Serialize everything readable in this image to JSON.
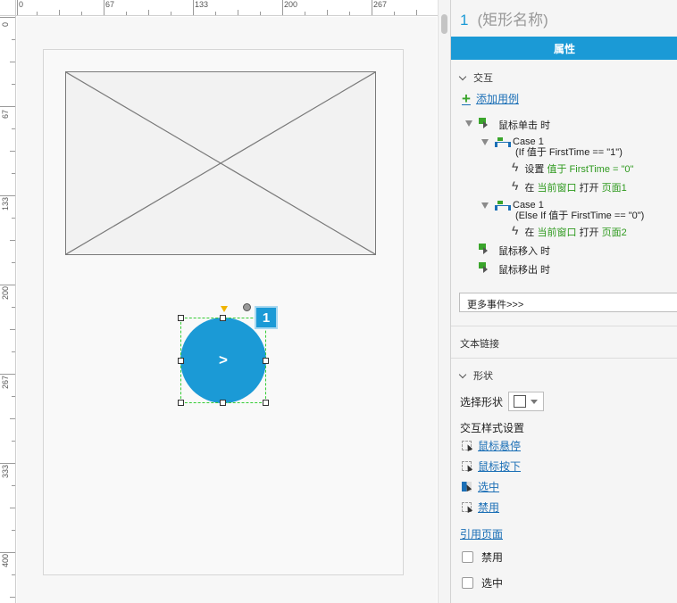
{
  "ruler": {
    "top_labels": [
      "0",
      "67",
      "133",
      "200",
      "267"
    ],
    "left_labels": [
      "0",
      "67",
      "133",
      "200",
      "267",
      "333",
      "400"
    ]
  },
  "canvas": {
    "button_label": ">",
    "badge_number": "1",
    "colors": {
      "accent": "#1b9ad6",
      "selection": "#33cc33"
    }
  },
  "panel": {
    "title_number": "1",
    "title_name": "(矩形名称)",
    "properties_tab": "属性",
    "interaction": {
      "section_label": "交互",
      "add_case_label": "添加用例",
      "events": [
        {
          "label": "鼠标单击 时",
          "cases": [
            {
              "name": "Case 1",
              "condition": "(If 值于 FirstTime == \"1\")",
              "actions": [
                {
                  "verb": "设置",
                  "detail": "值于 FirstTime = \"0\""
                },
                {
                  "verb": "在",
                  "detail1": "当前窗口",
                  "verb2": "打开",
                  "detail2": "页面1"
                }
              ]
            },
            {
              "name": "Case 1",
              "condition": "(Else If 值于 FirstTime == \"0\")",
              "actions": [
                {
                  "verb": "在",
                  "detail1": "当前窗口",
                  "verb2": "打开",
                  "detail2": "页面2"
                }
              ]
            }
          ]
        },
        {
          "label": "鼠标移入 时"
        },
        {
          "label": "鼠标移出 时"
        }
      ],
      "more_events_label": "更多事件>>>"
    },
    "text_link_label": "文本链接",
    "shape_section_label": "形状",
    "select_shape_label": "选择形状",
    "interaction_style_label": "交互样式设置",
    "style_links": [
      "鼠标悬停",
      "鼠标按下",
      "选中",
      "禁用"
    ],
    "page_ref_label": "引用页面",
    "checkboxes": [
      "禁用",
      "选中"
    ]
  }
}
